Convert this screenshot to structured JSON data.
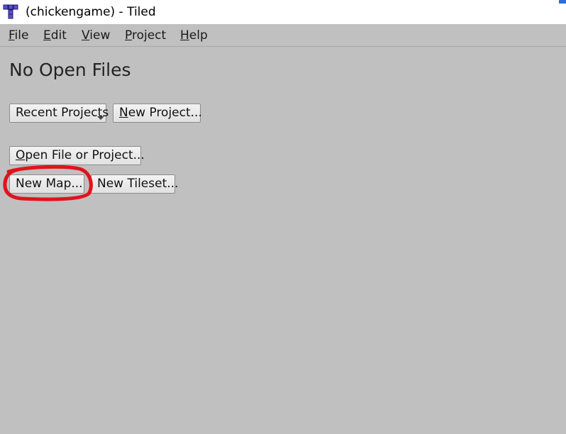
{
  "window": {
    "title": "(chickengame) - Tiled",
    "icon": "tiled-app-icon",
    "accent_color": "#2b6fd6"
  },
  "menubar": {
    "items": [
      {
        "label": "File"
      },
      {
        "label": "Edit"
      },
      {
        "label": "View"
      },
      {
        "label": "Project"
      },
      {
        "label": "Help"
      }
    ]
  },
  "main": {
    "heading": "No Open Files",
    "buttons": {
      "recent_projects": "Recent Projects",
      "new_project": "New Project...",
      "open_file_or_project": "Open File or Project...",
      "new_map": "New Map...",
      "new_tileset": "New Tileset..."
    }
  },
  "annotation": {
    "type": "hand-drawn-circle",
    "target": "new_map",
    "color": "#e0131b"
  }
}
